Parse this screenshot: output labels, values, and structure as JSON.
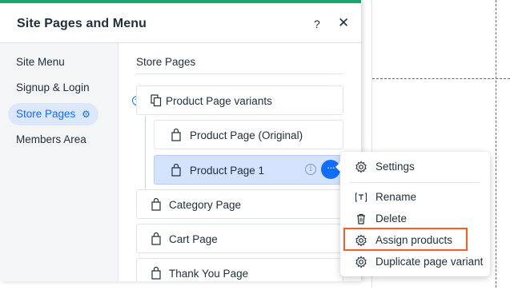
{
  "panel": {
    "title": "Site Pages and Menu",
    "help_label": "?",
    "close_label": "✕"
  },
  "sidebar": {
    "items": [
      {
        "label": "Site Menu",
        "active": false
      },
      {
        "label": "Signup & Login",
        "active": false
      },
      {
        "label": "Store Pages",
        "active": true,
        "icon": "gear-icon"
      },
      {
        "label": "Members Area",
        "active": false
      }
    ]
  },
  "content": {
    "section_title": "Store Pages",
    "pages": [
      {
        "label": "Product Page variants",
        "icon": "pages-stack-icon"
      },
      {
        "label": "Product Page (Original)",
        "icon": "shopping-bag-icon"
      },
      {
        "label": "Product Page 1",
        "icon": "shopping-bag-icon",
        "selected": true
      },
      {
        "label": "Category Page",
        "icon": "shopping-bag-icon"
      },
      {
        "label": "Cart Page",
        "icon": "shopping-bag-icon"
      },
      {
        "label": "Thank You Page",
        "icon": "shopping-bag-icon"
      }
    ],
    "collapse_label": "−",
    "info_label": "i",
    "more_label": "···"
  },
  "context_menu": {
    "items": [
      {
        "label": "Settings",
        "icon": "gear-icon"
      },
      {
        "label": "Rename",
        "icon": "rename-icon"
      },
      {
        "label": "Delete",
        "icon": "trash-icon"
      },
      {
        "label": "Assign products",
        "icon": "gear-icon",
        "highlighted": true
      },
      {
        "label": "Duplicate page variant",
        "icon": "gear-icon"
      }
    ]
  },
  "colors": {
    "accent": "#116dff",
    "header_bar": "#1fa470",
    "selected_bg": "#d3e3fd",
    "highlight_border": "#ff5a24"
  }
}
